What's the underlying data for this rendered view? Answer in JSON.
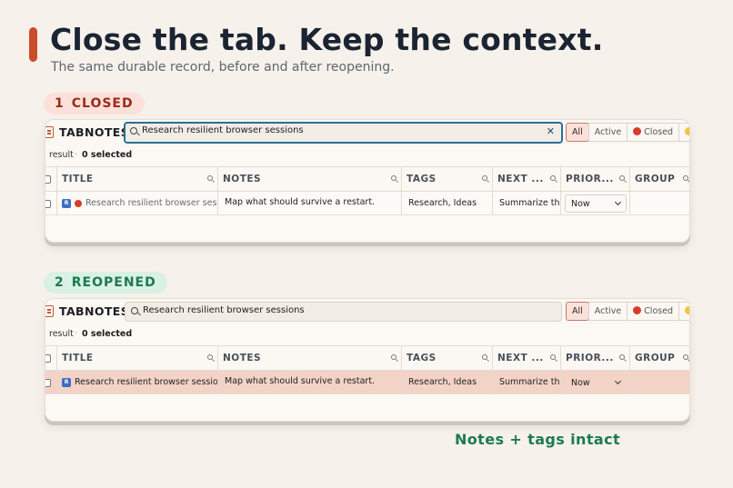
{
  "headline": "Close the tab. Keep the context.",
  "subhead": "The same durable record, before and after reopening.",
  "colors": {
    "accent": "#c94d2b",
    "closed": "#d83b2a",
    "reopened_row": "#f3d3c5",
    "positive": "#1d7a52"
  },
  "steps": [
    {
      "number": "1",
      "label": "CLOSED",
      "app_title": "TABNOTES",
      "search_value": "Research resilient browser sessions",
      "filters": [
        "All",
        "Active",
        "Closed"
      ],
      "status": {
        "results": "result",
        "separator": "·",
        "selected": "0 selected"
      },
      "columns": [
        "TITLE",
        "NOTES",
        "TAGS",
        "NEXT ...",
        "PRIOR...",
        "GROUP"
      ],
      "row": {
        "favicon_letter": "R",
        "title": "Research resilient browser ses...",
        "notes": "Map what should survive a restart.",
        "tags": "Research, Ideas",
        "next": "Summarize th",
        "priority": "Now",
        "group": ""
      }
    },
    {
      "number": "2",
      "label": "REOPENED",
      "app_title": "TABNOTES",
      "search_value": "Research resilient browser sessions",
      "filters": [
        "All",
        "Active",
        "Closed"
      ],
      "status": {
        "results": "result",
        "separator": "·",
        "selected": "0 selected"
      },
      "columns": [
        "TITLE",
        "NOTES",
        "TAGS",
        "NEXT ...",
        "PRIOR...",
        "GROUP"
      ],
      "row": {
        "favicon_letter": "R",
        "title": "Research resilient browser sessions",
        "notes": "Map what should survive a restart.",
        "tags": "Research, Ideas",
        "next": "Summarize th",
        "priority": "Now",
        "group": ""
      }
    }
  ],
  "footnote": "Notes + tags intact"
}
